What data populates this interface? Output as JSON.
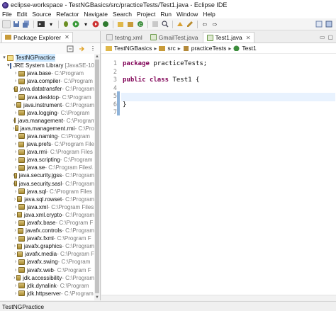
{
  "window": {
    "title": "eclipse-workspace - TestNGBasics/src/practiceTests/Test1.java - Eclipse IDE"
  },
  "menu": [
    "File",
    "Edit",
    "Source",
    "Refactor",
    "Navigate",
    "Search",
    "Project",
    "Run",
    "Window",
    "Help"
  ],
  "package_explorer": {
    "tab_label": "Package Explorer",
    "project": "TestNGPractice",
    "library": "JRE System Library",
    "library_version": "[JavaSE-10",
    "items": [
      {
        "name": "java.base",
        "path": " - C:\\Program"
      },
      {
        "name": "java.compiler",
        "path": " - C:\\Program"
      },
      {
        "name": "java.datatransfer",
        "path": " - C:\\Program"
      },
      {
        "name": "java.desktop",
        "path": " - C:\\Program"
      },
      {
        "name": "java.instrument",
        "path": " - C:\\Program"
      },
      {
        "name": "java.logging",
        "path": " - C:\\Program"
      },
      {
        "name": "java.management",
        "path": " - C:\\Program"
      },
      {
        "name": "java.management.rmi",
        "path": " - C:\\Pro"
      },
      {
        "name": "java.naming",
        "path": " - C:\\Program"
      },
      {
        "name": "java.prefs",
        "path": " - C:\\Program File"
      },
      {
        "name": "java.rmi",
        "path": " - C:\\Program Files"
      },
      {
        "name": "java.scripting",
        "path": " - C:\\Program"
      },
      {
        "name": "java.se",
        "path": " - C:\\Program Files\\"
      },
      {
        "name": "java.security.jgss",
        "path": " - C:\\Program"
      },
      {
        "name": "java.security.sasl",
        "path": " - C:\\Program"
      },
      {
        "name": "java.sql",
        "path": " - C:\\Program Files"
      },
      {
        "name": "java.sql.rowset",
        "path": " - C:\\Program"
      },
      {
        "name": "java.xml",
        "path": " - C:\\Program Files"
      },
      {
        "name": "java.xml.crypto",
        "path": " - C:\\Program"
      },
      {
        "name": "javafx.base",
        "path": " - C:\\Program F"
      },
      {
        "name": "javafx.controls",
        "path": " - C:\\Program"
      },
      {
        "name": "javafx.fxml",
        "path": " - C:\\Program F"
      },
      {
        "name": "javafx.graphics",
        "path": " - C:\\Program"
      },
      {
        "name": "javafx.media",
        "path": " - C:\\Program F"
      },
      {
        "name": "javafx.swing",
        "path": " - C:\\Program"
      },
      {
        "name": "javafx.web",
        "path": " - C:\\Program F"
      },
      {
        "name": "jdk.accessibility",
        "path": " - C:\\Program"
      },
      {
        "name": "jdk.dynalink",
        "path": " - C:\\Program"
      },
      {
        "name": "jdk.httpserver",
        "path": " - C:\\Program"
      }
    ]
  },
  "editor": {
    "tabs": [
      {
        "label": "testng.xml",
        "active": false
      },
      {
        "label": "GmailTest.java",
        "active": false
      },
      {
        "label": "Test1.java",
        "active": true
      }
    ],
    "breadcrumb": [
      "TestNGBasics",
      "src",
      "practiceTests",
      "Test1"
    ],
    "line_numbers": [
      "1",
      "2",
      "3",
      "4",
      "5",
      "6",
      "7"
    ],
    "code": {
      "line1_kw": "package",
      "line1_rest": " practiceTests;",
      "line3_kw1": "public",
      "line3_kw2": "class",
      "line3_rest": " Test1 {",
      "line6": "}"
    }
  },
  "status": {
    "selection": "TestNGPractice"
  },
  "colors": {
    "keyword": "#7f0055",
    "current_line": "#e8f2fe",
    "selection": "#cce8ff"
  }
}
